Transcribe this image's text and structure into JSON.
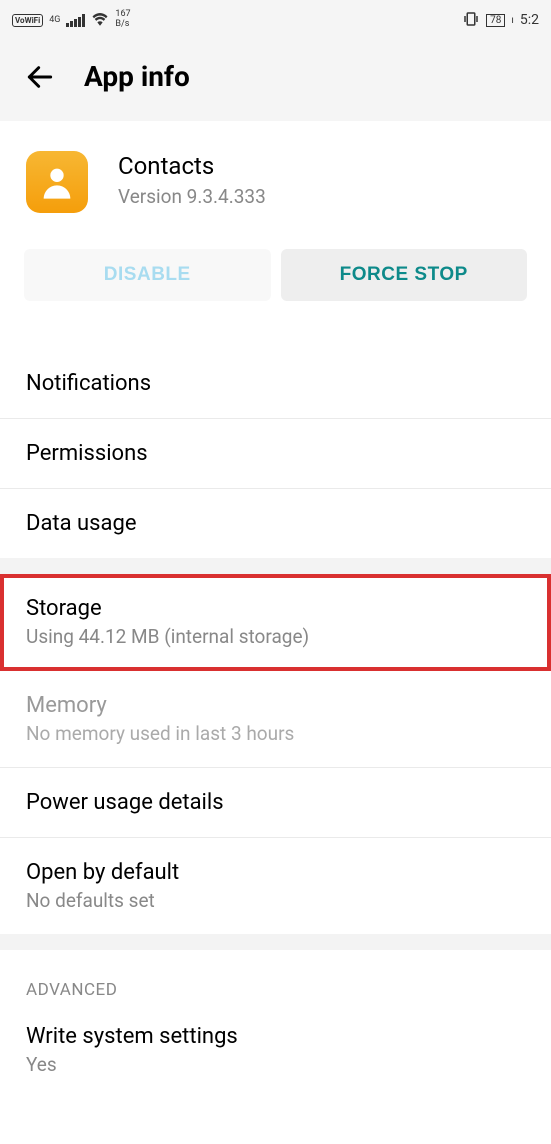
{
  "status": {
    "vowifi": "VoWiFi",
    "network": "4G",
    "speed_top": "167",
    "speed_bottom": "B/s",
    "battery": "78",
    "time": "5:2"
  },
  "header": {
    "title": "App info"
  },
  "app": {
    "name": "Contacts",
    "version": "Version 9.3.4.333"
  },
  "buttons": {
    "disable": "DISABLE",
    "force_stop": "FORCE STOP"
  },
  "items": {
    "notifications": "Notifications",
    "permissions": "Permissions",
    "data_usage": "Data usage",
    "storage_title": "Storage",
    "storage_sub": "Using 44.12 MB (internal storage)",
    "memory_title": "Memory",
    "memory_sub": "No memory used in last 3 hours",
    "power": "Power usage details",
    "open_title": "Open by default",
    "open_sub": "No defaults set"
  },
  "advanced": {
    "header": "ADVANCED",
    "write_title": "Write system settings",
    "write_sub": "Yes"
  }
}
